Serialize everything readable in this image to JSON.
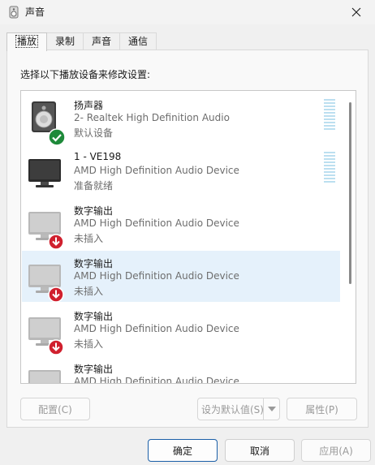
{
  "window": {
    "title": "声音",
    "icon": "speaker-icon"
  },
  "tabs": [
    {
      "label": "播放",
      "active": true
    },
    {
      "label": "录制",
      "active": false
    },
    {
      "label": "声音",
      "active": false
    },
    {
      "label": "通信",
      "active": false
    }
  ],
  "instruction": "选择以下播放设备来修改设置:",
  "devices": [
    {
      "name": "扬声器",
      "description": "2- Realtek High Definition Audio",
      "status": "默认设备",
      "icon": "speaker-default-icon",
      "badge": "checkmark"
    },
    {
      "name": "1 - VE198",
      "description": "AMD High Definition Audio Device",
      "status": "准备就绪",
      "icon": "monitor-icon",
      "badge": "none"
    },
    {
      "name": "数字输出",
      "description": "AMD High Definition Audio Device",
      "status": "未插入",
      "icon": "monitor-unplugged-icon",
      "badge": "unplugged"
    },
    {
      "name": "数字输出",
      "description": "AMD High Definition Audio Device",
      "status": "未插入",
      "icon": "monitor-unplugged-icon",
      "badge": "unplugged",
      "selected": true
    },
    {
      "name": "数字输出",
      "description": "AMD High Definition Audio Device",
      "status": "未插入",
      "icon": "monitor-unplugged-icon",
      "badge": "unplugged"
    },
    {
      "name": "数字输出",
      "description": "AMD High Definition Audio Device",
      "status": "",
      "icon": "monitor-unplugged-icon",
      "badge": "unplugged"
    }
  ],
  "buttons": {
    "configure": "配置(C)",
    "set_default": "设为默认值(S)",
    "properties": "属性(P)",
    "ok": "确定",
    "cancel": "取消",
    "apply": "应用(A)"
  },
  "colors": {
    "accent": "#1b5fa7",
    "selection": "#e5f1fb",
    "check_badge": "#1e8a3a",
    "unplug_badge": "#d0202e"
  }
}
